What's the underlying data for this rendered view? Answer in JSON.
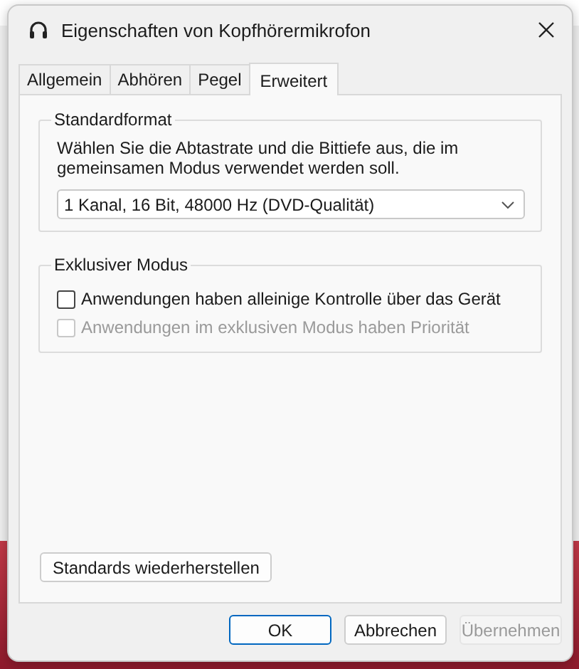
{
  "window": {
    "title": "Eigenschaften von Kopfhörermikrofon"
  },
  "tabs": [
    {
      "label": "Allgemein",
      "selected": false
    },
    {
      "label": "Abhören",
      "selected": false
    },
    {
      "label": "Pegel",
      "selected": false
    },
    {
      "label": "Erweitert",
      "selected": true
    }
  ],
  "default_format": {
    "title": "Standardformat",
    "description": "Wählen Sie die Abtastrate und die Bittiefe aus, die im gemeinsamen Modus verwendet werden soll.",
    "dropdown_value": "1 Kanal, 16 Bit, 48000 Hz (DVD-Qualität)"
  },
  "exclusive_mode": {
    "title": "Exklusiver Modus",
    "options": [
      {
        "label": "Anwendungen haben alleinige Kontrolle über das Gerät",
        "checked": false,
        "disabled": false
      },
      {
        "label": "Anwendungen im exklusiven Modus haben Priorität",
        "checked": false,
        "disabled": true
      }
    ]
  },
  "restore_button": {
    "label": "Standards wiederherstellen"
  },
  "buttons": [
    {
      "label": "OK",
      "kind": "default",
      "disabled": false
    },
    {
      "label": "Abbrechen",
      "kind": "normal",
      "disabled": false
    },
    {
      "label": "Übernehmen",
      "kind": "normal",
      "disabled": true
    }
  ]
}
